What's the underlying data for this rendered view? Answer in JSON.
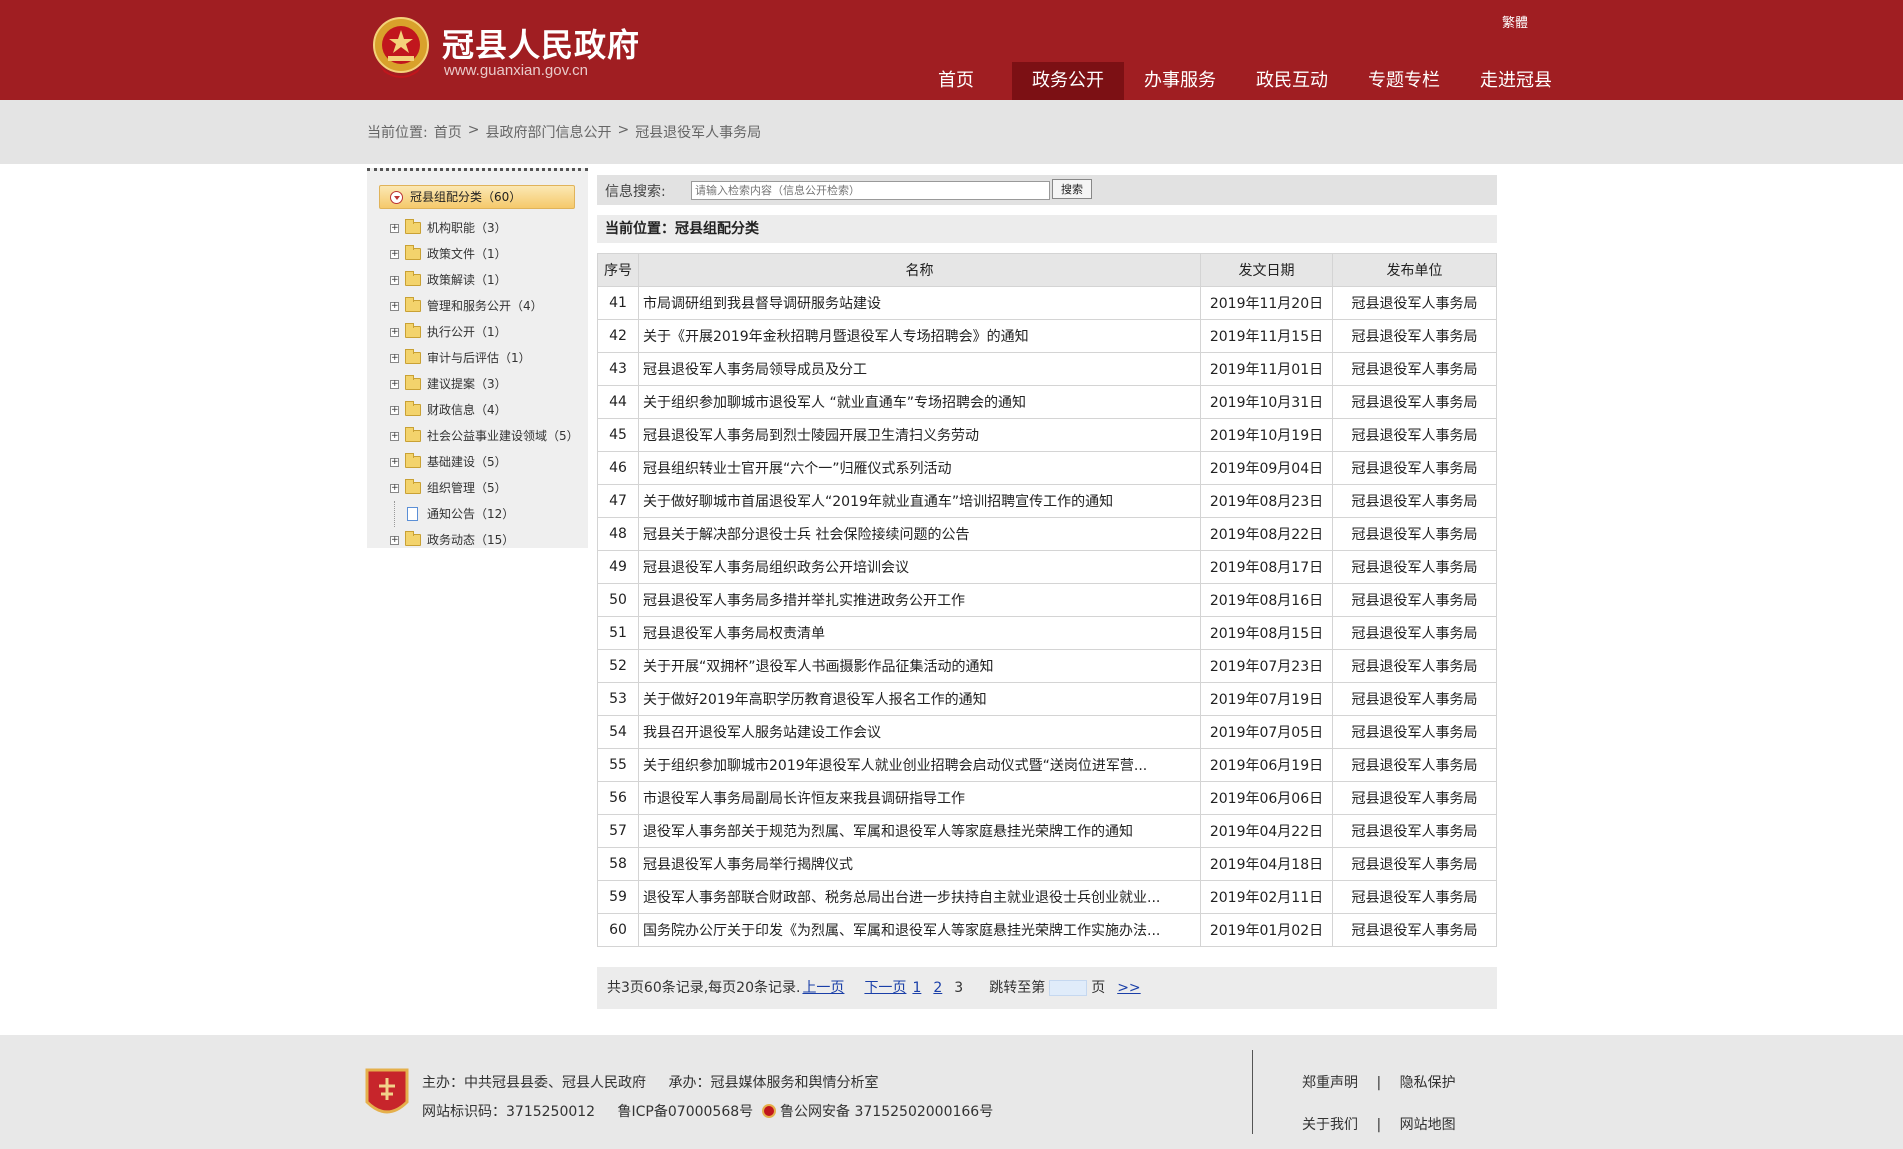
{
  "header": {
    "title": "冠县人民政府",
    "url": "www.guanxian.gov.cn",
    "trad": "繁體"
  },
  "nav": [
    {
      "label": "首页"
    },
    {
      "label": "政务公开"
    },
    {
      "label": "办事服务"
    },
    {
      "label": "政民互动"
    },
    {
      "label": "专题专栏"
    },
    {
      "label": "走进冠县"
    }
  ],
  "nav_active": "政务公开",
  "breadcrumb": {
    "prefix": "当前位置:",
    "items": [
      "首页",
      ">",
      "县政府部门信息公开",
      ">",
      "冠县退役军人事务局"
    ]
  },
  "tree": {
    "root": "冠县组配分类（60）",
    "nodes": [
      {
        "label": "机构职能（3）",
        "icon": "folder-icon"
      },
      {
        "label": "政策文件（1）",
        "icon": "folder-icon"
      },
      {
        "label": "政策解读（1）",
        "icon": "folder-icon"
      },
      {
        "label": "管理和服务公开（4）",
        "icon": "folder-icon"
      },
      {
        "label": "执行公开（1）",
        "icon": "folder-icon"
      },
      {
        "label": "审计与后评估（1）",
        "icon": "folder-icon"
      },
      {
        "label": "建议提案（3）",
        "icon": "folder-icon"
      },
      {
        "label": "财政信息（4）",
        "icon": "folder-icon"
      },
      {
        "label": "社会公益事业建设领域（5）",
        "icon": "folder-icon"
      },
      {
        "label": "基础建设（5）",
        "icon": "folder-icon"
      },
      {
        "label": "组织管理（5）",
        "icon": "folder-icon"
      },
      {
        "label": "通知公告（12）",
        "icon": "document-icon"
      },
      {
        "label": "政务动态（15）",
        "icon": "folder-icon"
      }
    ]
  },
  "search": {
    "label": "信息搜索:",
    "placeholder": "请输入检索内容（信息公开检索）",
    "button": "搜索"
  },
  "position": "当前位置：冠县组配分类",
  "table": {
    "headers": [
      "序号",
      "名称",
      "发文日期",
      "发布单位"
    ],
    "rows": [
      [
        "41",
        "市局调研组到我县督导调研服务站建设",
        "2019年11月20日",
        "冠县退役军人事务局"
      ],
      [
        "42",
        "关于《开展2019年金秋招聘月暨退役军人专场招聘会》的通知",
        "2019年11月15日",
        "冠县退役军人事务局"
      ],
      [
        "43",
        "冠县退役军人事务局领导成员及分工",
        "2019年11月01日",
        "冠县退役军人事务局"
      ],
      [
        "44",
        "关于组织参加聊城市退役军人 “就业直通车”专场招聘会的通知",
        "2019年10月31日",
        "冠县退役军人事务局"
      ],
      [
        "45",
        "冠县退役军人事务局到烈士陵园开展卫生清扫义务劳动",
        "2019年10月19日",
        "冠县退役军人事务局"
      ],
      [
        "46",
        "冠县组织转业士官开展“六个一”归雁仪式系列活动",
        "2019年09月04日",
        "冠县退役军人事务局"
      ],
      [
        "47",
        "关于做好聊城市首届退役军人“2019年就业直通车”培训招聘宣传工作的通知",
        "2019年08月23日",
        "冠县退役军人事务局"
      ],
      [
        "48",
        "冠县关于解决部分退役士兵 社会保险接续问题的公告",
        "2019年08月22日",
        "冠县退役军人事务局"
      ],
      [
        "49",
        "冠县退役军人事务局组织政务公开培训会议",
        "2019年08月17日",
        "冠县退役军人事务局"
      ],
      [
        "50",
        "冠县退役军人事务局多措并举扎实推进政务公开工作",
        "2019年08月16日",
        "冠县退役军人事务局"
      ],
      [
        "51",
        "冠县退役军人事务局权责清单",
        "2019年08月15日",
        "冠县退役军人事务局"
      ],
      [
        "52",
        "关于开展“双拥杯”退役军人书画摄影作品征集活动的通知",
        "2019年07月23日",
        "冠县退役军人事务局"
      ],
      [
        "53",
        "关于做好2019年高职学历教育退役军人报名工作的通知",
        "2019年07月19日",
        "冠县退役军人事务局"
      ],
      [
        "54",
        "我县召开退役军人服务站建设工作会议",
        "2019年07月05日",
        "冠县退役军人事务局"
      ],
      [
        "55",
        "关于组织参加聊城市2019年退役军人就业创业招聘会启动仪式暨“送岗位进军营...",
        "2019年06月19日",
        "冠县退役军人事务局"
      ],
      [
        "56",
        "市退役军人事务局副局长许恒友来我县调研指导工作",
        "2019年06月06日",
        "冠县退役军人事务局"
      ],
      [
        "57",
        "退役军人事务部关于规范为烈属、军属和退役军人等家庭悬挂光荣牌工作的通知",
        "2019年04月22日",
        "冠县退役军人事务局"
      ],
      [
        "58",
        "冠县退役军人事务局举行揭牌仪式",
        "2019年04月18日",
        "冠县退役军人事务局"
      ],
      [
        "59",
        "退役军人事务部联合财政部、税务总局出台进一步扶持自主就业退役士兵创业就业...",
        "2019年02月11日",
        "冠县退役军人事务局"
      ],
      [
        "60",
        "国务院办公厅关于印发《为烈属、军属和退役军人等家庭悬挂光荣牌工作实施办法...",
        "2019年01月02日",
        "冠县退役军人事务局"
      ]
    ]
  },
  "pager": {
    "summary": "共3页60条记录,每页20条记录.",
    "prev": "上一页",
    "next": "下一页",
    "p1": "1",
    "p2": "2",
    "p3": "3",
    "jump_prefix": "跳转至第",
    "jump_suffix": "页",
    "go": ">>"
  },
  "footer": {
    "line1a": "主办：中共冠县县委、冠县人民政府",
    "line1b": "承办：冠县媒体服务和舆情分析室",
    "line2a": "网站标识码：3715250012",
    "line2b": "鲁ICP备07000568号",
    "line2c": "鲁公网安备 37152502000166号",
    "link1": "郑重声明",
    "link2": "隐私保护",
    "link3": "关于我们",
    "link4": "网站地图",
    "sep": "|"
  },
  "colors": {
    "brand": "#a01e22",
    "active_nav": "#7c1014"
  }
}
